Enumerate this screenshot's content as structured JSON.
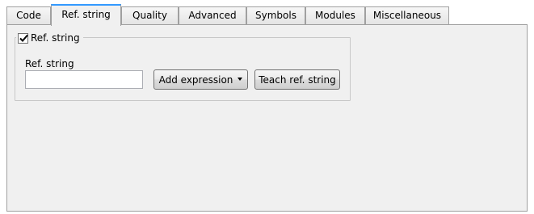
{
  "tabs": [
    {
      "label": "Code",
      "active": false
    },
    {
      "label": "Ref. string",
      "active": true
    },
    {
      "label": "Quality",
      "active": false
    },
    {
      "label": "Advanced",
      "active": false
    },
    {
      "label": "Symbols",
      "active": false
    },
    {
      "label": "Modules",
      "active": false
    },
    {
      "label": "Miscellaneous",
      "active": false
    }
  ],
  "group": {
    "checkbox_label": "Ref. string",
    "checked": true,
    "field_label": "Ref. string",
    "field_value": "",
    "field_placeholder": "",
    "add_expression_label": "Add expression",
    "teach_label": "Teach ref. string"
  },
  "icons": {
    "checkbox": "checkmark-icon",
    "dropdown": "caret-down-icon"
  },
  "colors": {
    "active_tab_accent": "#3399ff",
    "panel_background": "#f0f0f0",
    "border": "#a0a0a0"
  }
}
